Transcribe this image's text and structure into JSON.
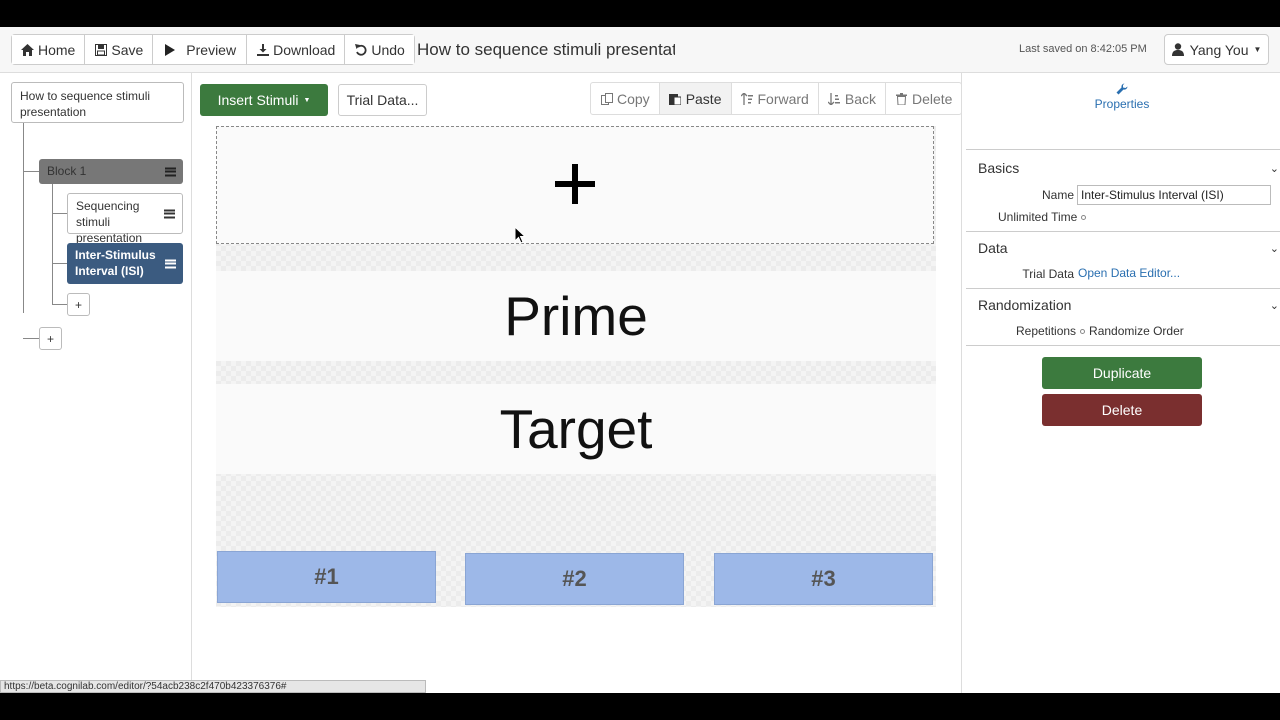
{
  "toolbar": {
    "home": "Home",
    "save": "Save",
    "preview": "Preview",
    "download": "Download",
    "undo": "Undo",
    "doc_title": "How to sequence stimuli presentatio",
    "last_saved": "Last saved on 8:42:05 PM",
    "user": "Yang You"
  },
  "tree": {
    "root": "How to sequence stimuli presentation",
    "block": "Block 1",
    "items": [
      "Sequencing stimuli presentation",
      "Inter-Stimulus Interval (ISI)"
    ],
    "add": "+"
  },
  "center": {
    "insert_stimuli": "Insert Stimuli",
    "trial_data": "Trial Data...",
    "edit": {
      "copy": "Copy",
      "paste": "Paste",
      "forward": "Forward",
      "back": "Back",
      "delete": "Delete"
    },
    "stimuli": {
      "prime": "Prime",
      "target": "Target"
    },
    "responses": [
      "#1",
      "#2",
      "#3"
    ]
  },
  "properties": {
    "tab": "Properties",
    "basics": "Basics",
    "name_label": "Name",
    "name_value": "Inter-Stimulus Interval (ISI)",
    "unlimited_time": "Unlimited Time",
    "data": "Data",
    "trial_data_label": "Trial Data",
    "open_editor": "Open Data Editor...",
    "randomization": "Randomization",
    "repetitions": "Repetitions",
    "randomize_order": "Randomize Order",
    "duplicate": "Duplicate",
    "delete": "Delete"
  },
  "status_url": "https://beta.cognilab.com/editor/?54acb238c2f470b4233763​76#"
}
